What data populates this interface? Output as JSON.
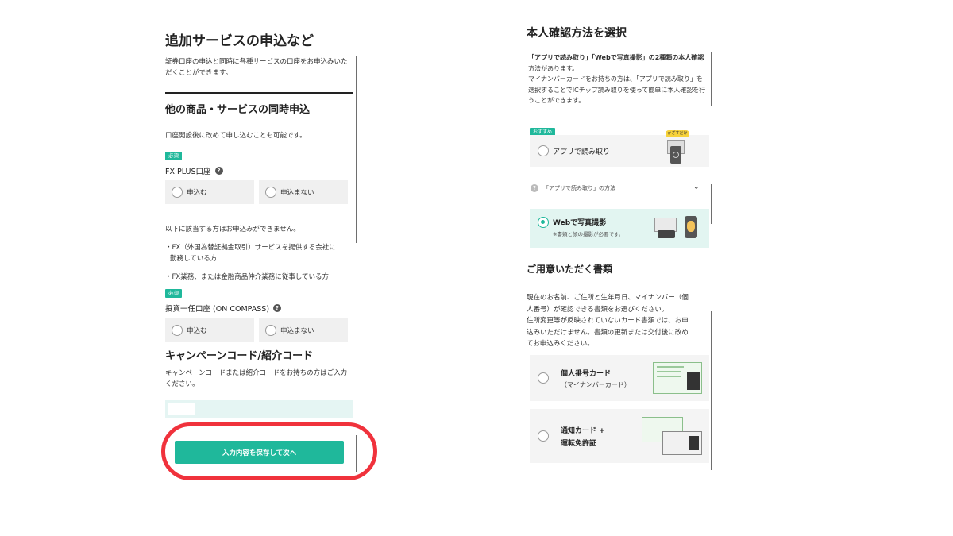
{
  "left": {
    "title": "追加サービスの申込など",
    "intro": "証券口座の申込と同時に各種サービスの口座をお申込みいただくことができます。",
    "intro_l1": "証券口座の申込と同時に各種サービスの口座をお申込みいた",
    "intro_l2": "だくことができます。",
    "section_title": "他の商品・サービスの同時申込",
    "section_note": "口座開設後に改めて申し込むことも可能です。",
    "required": "必須",
    "fx": {
      "label": "FX PLUS口座",
      "opt_yes": "申込む",
      "opt_no": "申込まない"
    },
    "notice": "以下に該当する方はお申込みができません。",
    "bullet1_l1": "・FX（外国為替証拠金取引）サービスを提供する会社に",
    "bullet1_l2": "勤務している方",
    "bullet2": "・FX業務、または金融商品仲介業務に従事している方",
    "compass": {
      "label": "投資一任口座 (ON COMPASS)",
      "opt_yes": "申込む",
      "opt_no": "申込まない"
    },
    "campaign_title": "キャンペーンコード/紹介コード",
    "campaign_l1": "キャンペーンコードまたは紹介コードをお持ちの方はご入力",
    "campaign_l2": "ください。",
    "submit": "入力内容を保存して次へ"
  },
  "right": {
    "title": "本人確認方法を選択",
    "desc_l1": "「アプリで読み取り」「Webで写真撮影」の2種類の本人確認",
    "desc_l2": "方法があります。",
    "desc_l3": "マイナンバーカードをお持ちの方は、「アプリで読み取り」を",
    "desc_l4": "選択することでICチップ読み取りを使って簡単に本人確認を行",
    "desc_l5": "うことができます。",
    "recommend": "おすすめ",
    "app_option": "アプリで読み取り",
    "app_badge": "かざすだけ",
    "howto": "「アプリで読み取り」の方法",
    "web_option": "Webで写真撮影",
    "web_note": "※書類と顔の撮影が必要です。",
    "docs_title": "ご用意いただく書類",
    "docs_l1": "現在のお名前、ご住所と生年月日、マイナンバー（個",
    "docs_l2": "人番号）が確認できる書類をお選びください。",
    "docs_l3": "住所変更等が反映されていないカード書類では、お申",
    "docs_l4": "込みいただけません。書類の更新または交付後に改め",
    "docs_l5": "てお申込みください。",
    "doc1_title": "個人番号カード",
    "doc1_sub": "（マイナンバーカード）",
    "doc2_l1": "通知カード +",
    "doc2_l2": "運転免許証"
  },
  "colors": {
    "accent": "#1fb89b",
    "highlight": "#f0323c"
  }
}
